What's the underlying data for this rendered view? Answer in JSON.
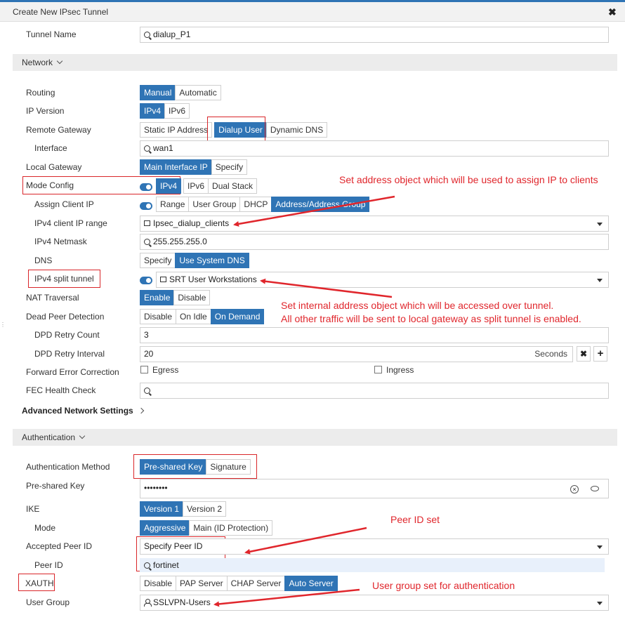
{
  "window": {
    "title": "Create New IPsec Tunnel",
    "close_glyph": "✖"
  },
  "tunnel_name": {
    "label": "Tunnel Name",
    "value": "dialup_P1"
  },
  "network": {
    "header": "Network",
    "routing": {
      "label": "Routing",
      "options": [
        "Manual",
        "Automatic"
      ],
      "selected": "Manual"
    },
    "ip_version": {
      "label": "IP Version",
      "options": [
        "IPv4",
        "IPv6"
      ],
      "selected": "IPv4"
    },
    "remote_gateway": {
      "label": "Remote Gateway",
      "options": [
        "Static IP Address",
        "Dialup User",
        "Dynamic DNS"
      ],
      "selected": "Dialup User"
    },
    "interface": {
      "label": "Interface",
      "value": "wan1"
    },
    "local_gateway": {
      "label": "Local Gateway",
      "options": [
        "Main Interface IP",
        "Specify"
      ],
      "selected": "Main Interface IP"
    },
    "mode_config": {
      "label": "Mode Config",
      "options": [
        "IPv4",
        "IPv6",
        "Dual Stack"
      ],
      "selected": "IPv4",
      "enabled": true
    },
    "assign_client_ip": {
      "label": "Assign Client IP",
      "options": [
        "Range",
        "User Group",
        "DHCP",
        "Address/Address Group"
      ],
      "selected": "Address/Address Group",
      "enabled": true
    },
    "ipv4_client_ip_range": {
      "label": "IPv4 client IP range",
      "value": "Ipsec_dialup_clients"
    },
    "ipv4_netmask": {
      "label": "IPv4 Netmask",
      "value": "255.255.255.0"
    },
    "dns": {
      "label": "DNS",
      "options": [
        "Specify",
        "Use System DNS"
      ],
      "selected": "Use System DNS"
    },
    "ipv4_split_tunnel": {
      "label": "IPv4 split tunnel",
      "value": "SRT User Workstations",
      "enabled": true
    },
    "nat_traversal": {
      "label": "NAT Traversal",
      "options": [
        "Enable",
        "Disable"
      ],
      "selected": "Enable"
    },
    "dead_peer_detection": {
      "label": "Dead Peer Detection",
      "options": [
        "Disable",
        "On Idle",
        "On Demand"
      ],
      "selected": "On Demand"
    },
    "dpd_retry_count": {
      "label": "DPD Retry Count",
      "value": "3"
    },
    "dpd_retry_interval": {
      "label": "DPD Retry Interval",
      "value": "20",
      "unit": "Seconds",
      "remove_glyph": "✖",
      "add_glyph": "+"
    },
    "forward_error_correction": {
      "label": "Forward Error Correction",
      "egress": "Egress",
      "ingress": "Ingress"
    },
    "fec_health_check": {
      "label": "FEC Health Check",
      "value": ""
    },
    "advanced": "Advanced Network Settings"
  },
  "authentication": {
    "header": "Authentication",
    "method": {
      "label": "Authentication Method",
      "options": [
        "Pre-shared Key",
        "Signature"
      ],
      "selected": "Pre-shared Key"
    },
    "psk": {
      "label": "Pre-shared Key",
      "value": "••••••••"
    },
    "ike": {
      "label": "IKE",
      "options": [
        "Version 1",
        "Version 2"
      ],
      "selected": "Version 1"
    },
    "mode": {
      "label": "Mode",
      "options": [
        "Aggressive",
        "Main (ID Protection)"
      ],
      "selected": "Aggressive"
    },
    "accepted_peer_id": {
      "label": "Accepted Peer ID",
      "value": "Specify Peer ID"
    },
    "peer_id": {
      "label": "Peer ID",
      "value": "fortinet"
    },
    "xauth": {
      "label": "XAUTH",
      "options": [
        "Disable",
        "PAP Server",
        "CHAP Server",
        "Auto Server"
      ],
      "selected": "Auto Server"
    },
    "user_group": {
      "label": "User Group",
      "value": "SSLVPN-Users"
    }
  },
  "annotations": {
    "a1": "Set address object which will be used to assign IP to clients",
    "a2_line1": "Set internal address object which will be accessed over tunnel.",
    "a2_line2": "All other traffic will be sent to local gateway as split tunnel is enabled.",
    "a3": "Peer ID set",
    "a4": "User group set for authentication"
  },
  "colors": {
    "accent": "#2f74b5",
    "annotation": "#e0262c",
    "section_bg": "#ececec"
  }
}
